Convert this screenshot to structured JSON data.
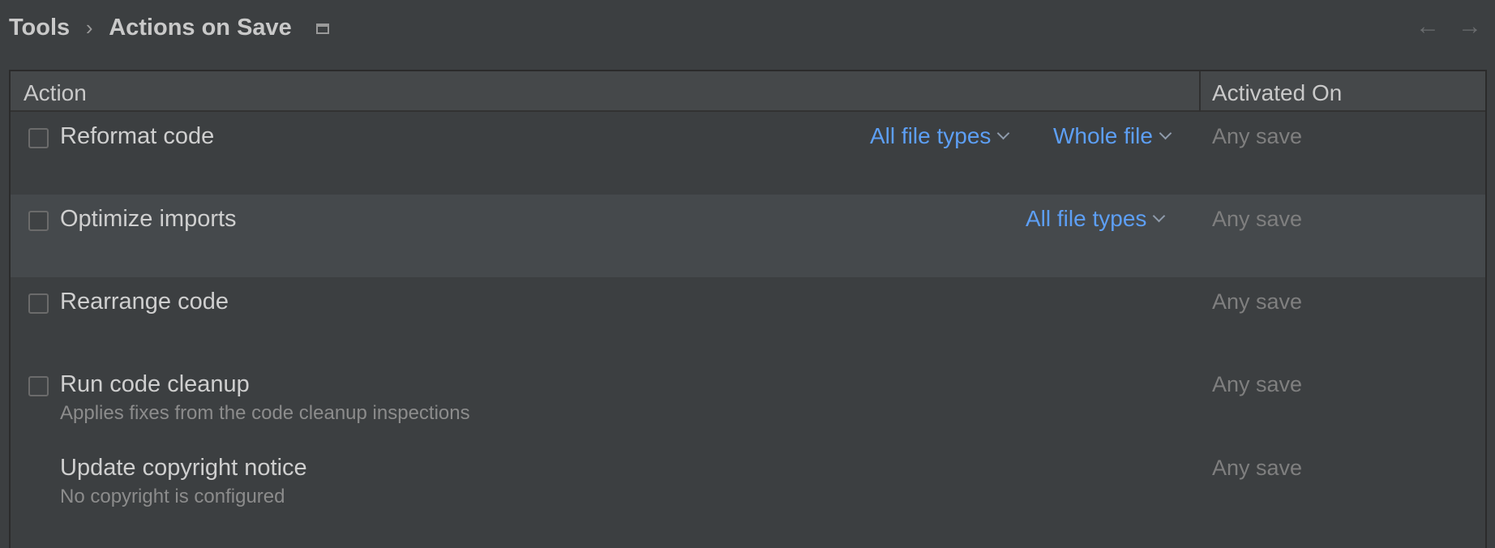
{
  "breadcrumb": {
    "parent": "Tools",
    "separator": "›",
    "current": "Actions on Save"
  },
  "nav": {
    "back_icon": "←",
    "forward_icon": "→"
  },
  "table": {
    "columns": {
      "action": "Action",
      "activated_on": "Activated On"
    },
    "rows": [
      {
        "label": "Reformat code",
        "description": "",
        "checked": false,
        "dropdowns": [
          "All file types",
          "Whole file"
        ],
        "activated_on": "Any save"
      },
      {
        "label": "Optimize imports",
        "description": "",
        "checked": false,
        "dropdowns": [
          "All file types"
        ],
        "activated_on": "Any save"
      },
      {
        "label": "Rearrange code",
        "description": "",
        "checked": false,
        "dropdowns": [],
        "activated_on": "Any save"
      },
      {
        "label": "Run code cleanup",
        "description": "Applies fixes from the code cleanup inspections",
        "checked": false,
        "dropdowns": [],
        "activated_on": "Any save"
      },
      {
        "label": "Update copyright notice",
        "description": "No copyright is configured",
        "checked": null,
        "dropdowns": [],
        "activated_on": "Any save"
      }
    ]
  },
  "colors": {
    "background": "#3c3f41",
    "header_bg": "#45484a",
    "highlight_row": "#45494c",
    "link": "#5d9ff5",
    "muted_text": "#7f7f7f"
  }
}
